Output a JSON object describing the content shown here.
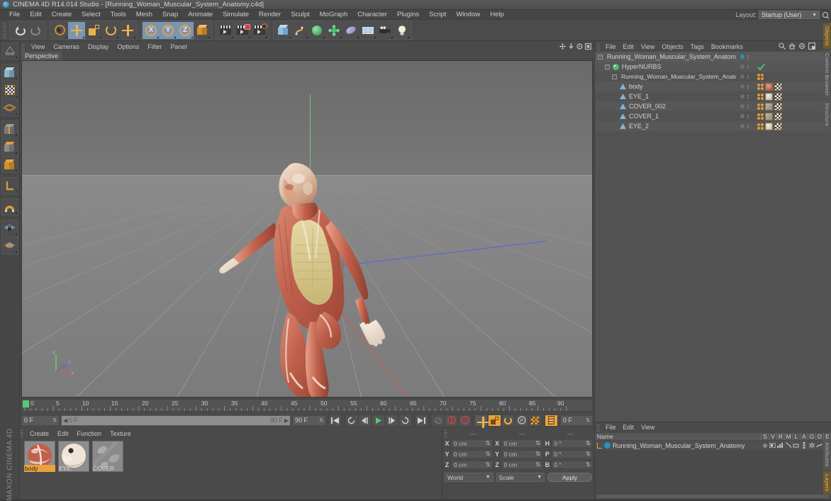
{
  "titlebar": {
    "app_icon": "cinema4d-logo-icon",
    "title": "CINEMA 4D R14.014 Studio - [Running_Woman_Muscular_System_Anatomy.c4d]"
  },
  "menubar": {
    "items": [
      "File",
      "Edit",
      "Create",
      "Select",
      "Tools",
      "Mesh",
      "Snap",
      "Animate",
      "Simulate",
      "Render",
      "Sculpt",
      "MoGraph",
      "Character",
      "Plugins",
      "Script",
      "Window",
      "Help"
    ],
    "layout_label": "Layout:",
    "layout_value": "Startup (User)",
    "search_icon": "magnifier-icon"
  },
  "toolbar": {
    "groups": [
      {
        "name": "history",
        "buttons": [
          {
            "icon": "undo-icon",
            "state": "normal"
          },
          {
            "icon": "redo-icon",
            "state": "disabled"
          }
        ]
      },
      {
        "name": "transform",
        "buttons": [
          {
            "icon": "selection-live-icon",
            "state": "normal"
          },
          {
            "icon": "move-icon",
            "state": "selected"
          },
          {
            "icon": "scale-icon",
            "state": "normal"
          },
          {
            "icon": "rotate-icon",
            "state": "normal"
          },
          {
            "icon": "add-move-icon",
            "state": "normal"
          }
        ]
      },
      {
        "name": "axis-locks",
        "buttons": [
          {
            "icon": "x-axis-icon",
            "state": "selected"
          },
          {
            "icon": "y-axis-icon",
            "state": "selected"
          },
          {
            "icon": "z-axis-icon",
            "state": "selected"
          },
          {
            "icon": "world-object-axis-icon",
            "state": "normal"
          }
        ]
      },
      {
        "name": "render",
        "buttons": [
          {
            "icon": "render-view-icon",
            "state": "normal"
          },
          {
            "icon": "render-region-icon",
            "state": "normal"
          },
          {
            "icon": "render-settings-icon",
            "state": "normal"
          }
        ]
      },
      {
        "name": "objects",
        "buttons": [
          {
            "icon": "cube-primitive-icon",
            "state": "normal"
          },
          {
            "icon": "spline-pen-icon",
            "state": "normal"
          },
          {
            "icon": "nurbs-icon",
            "state": "normal"
          },
          {
            "icon": "array-modeling-icon",
            "state": "normal"
          },
          {
            "icon": "deformer-icon",
            "state": "normal"
          },
          {
            "icon": "environment-icon",
            "state": "normal"
          },
          {
            "icon": "camera-icon",
            "state": "normal"
          },
          {
            "icon": "light-icon",
            "state": "normal"
          }
        ]
      }
    ]
  },
  "left_toolbar": {
    "buttons": [
      {
        "icon": "make-editable-icon"
      },
      {
        "icon": "model-mode-icon"
      },
      {
        "icon": "texture-mode-icon"
      },
      {
        "icon": "points-mode-icon"
      },
      {
        "icon": "edges-mode-icon"
      },
      {
        "icon": "polygons-mode-icon"
      },
      {
        "icon": "axis-mode-icon"
      },
      {
        "icon": "workplane-icon"
      },
      {
        "icon": "magnet-icon"
      },
      {
        "icon": "lock-workplane-icon"
      },
      {
        "icon": "planar-workplane-icon"
      }
    ],
    "brand": "MAXON CINEMA 4D"
  },
  "viewport": {
    "menu_items": [
      "View",
      "Cameras",
      "Display",
      "Options",
      "Filter",
      "Panel"
    ],
    "view_label": "Perspective",
    "nav_icons": [
      "pan-icon",
      "zoom-icon",
      "rotate-icon",
      "maximize-viewport-icon"
    ],
    "axis_gizmo": [
      "x-axis-red",
      "y-axis-green",
      "z-axis-blue"
    ],
    "scene_description": "Running woman muscular system anatomy 3D model on grey perspective grid"
  },
  "timeline": {
    "ruler_labels": [
      "0",
      "5",
      "10",
      "15",
      "20",
      "25",
      "30",
      "35",
      "40",
      "45",
      "50",
      "55",
      "60",
      "65",
      "70",
      "75",
      "80",
      "85",
      "90"
    ],
    "range_start": 0,
    "range_end": 90,
    "current_frame": 0,
    "current_frame_field": "0 F",
    "preview_start_field": "0 F",
    "preview_end_field": "90 F",
    "end_frame_field": "90 F",
    "right_frame_field": "0 F",
    "transport": [
      {
        "icon": "go-to-start-icon"
      },
      {
        "icon": "previous-key-icon"
      },
      {
        "icon": "step-back-icon"
      },
      {
        "icon": "play-icon"
      },
      {
        "icon": "step-forward-icon"
      },
      {
        "icon": "next-key-icon"
      },
      {
        "icon": "go-to-end-icon"
      }
    ],
    "record_group": [
      {
        "icon": "autokey-icon"
      },
      {
        "icon": "record-active-objects-icon"
      },
      {
        "icon": "record-question-icon"
      }
    ],
    "key_group": [
      {
        "icon": "key-position-icon"
      },
      {
        "icon": "key-scale-icon"
      },
      {
        "icon": "key-rotation-icon"
      },
      {
        "icon": "key-param-icon"
      },
      {
        "icon": "key-pla-icon"
      },
      {
        "icon": "timeline-icon"
      }
    ]
  },
  "material_manager": {
    "menu_items": [
      "Create",
      "Edit",
      "Function",
      "Texture"
    ],
    "materials": [
      {
        "name": "body",
        "selected": true,
        "swatch": "muscle-red"
      },
      {
        "name": "EYE",
        "selected": false,
        "swatch": "eye-cream"
      },
      {
        "name": "COVER",
        "selected": false,
        "swatch": "cover-grey"
      }
    ]
  },
  "coordinates": {
    "column_headers": [
      "—",
      "—",
      "—"
    ],
    "position": [
      {
        "label": "X",
        "value": "0 cm"
      },
      {
        "label": "Y",
        "value": "0 cm"
      },
      {
        "label": "Z",
        "value": "0 cm"
      }
    ],
    "size": [
      {
        "label": "X",
        "value": "0 cm"
      },
      {
        "label": "Y",
        "value": "0 cm"
      },
      {
        "label": "Z",
        "value": "0 cm"
      }
    ],
    "rotation": [
      {
        "label": "H",
        "value": "0 °"
      },
      {
        "label": "P",
        "value": "0 °"
      },
      {
        "label": "B",
        "value": "0 °"
      }
    ],
    "coord_system": "World",
    "mode": "Scale",
    "apply_label": "Apply"
  },
  "object_manager": {
    "menu_items": [
      "File",
      "Edit",
      "View",
      "Objects",
      "Tags",
      "Bookmarks"
    ],
    "tool_icons": [
      "search-icon",
      "home-icon",
      "minus-icon",
      "new-window-icon"
    ],
    "rows": [
      {
        "name": "Running_Woman_Muscular_System_Anatomy",
        "depth": 0,
        "icon": "null-object-icon",
        "expander": "-",
        "dot": "on",
        "check": false,
        "tags": []
      },
      {
        "name": "HyperNURBS",
        "depth": 1,
        "icon": "hypernurbs-icon",
        "expander": "-",
        "dot": "off",
        "check": true,
        "tags": []
      },
      {
        "name": "Running_Woman_Muscular_System_Anatomy",
        "depth": 2,
        "icon": "null-object-icon",
        "expander": "-",
        "dot": "off",
        "check": false,
        "tags": [
          "dots"
        ]
      },
      {
        "name": "body",
        "depth": 3,
        "icon": "polygon-object-icon",
        "expander": "",
        "dot": "off",
        "check": false,
        "tags": [
          "dots",
          "material-muscle",
          "uvw-checker"
        ]
      },
      {
        "name": "EYE_1",
        "depth": 3,
        "icon": "polygon-object-icon",
        "expander": "",
        "dot": "off",
        "check": false,
        "tags": [
          "dots",
          "material-eye",
          "uvw-checker"
        ]
      },
      {
        "name": "COVER_002",
        "depth": 3,
        "icon": "polygon-object-icon",
        "expander": "",
        "dot": "off",
        "check": false,
        "tags": [
          "dots",
          "material-cover",
          "uvw-checker"
        ]
      },
      {
        "name": "COVER_1",
        "depth": 3,
        "icon": "polygon-object-icon",
        "expander": "",
        "dot": "off",
        "check": false,
        "tags": [
          "dots",
          "material-cover",
          "uvw-checker"
        ]
      },
      {
        "name": "EYE_2",
        "depth": 3,
        "icon": "polygon-object-icon",
        "expander": "",
        "dot": "off",
        "check": false,
        "tags": [
          "dots",
          "material-eye",
          "uvw-checker"
        ]
      }
    ]
  },
  "attribute_manager": {
    "menu_items": [
      "File",
      "Edit",
      "View"
    ],
    "name_header": "Name",
    "column_headers": [
      "S",
      "V",
      "R",
      "M",
      "L",
      "A",
      "G",
      "D",
      "E"
    ],
    "rows": [
      {
        "name": "Running_Woman_Muscular_System_Anatomy",
        "swatch": "#2b8fc4"
      }
    ]
  },
  "side_tabs": {
    "top": [
      {
        "label": "Objects",
        "active": true
      },
      {
        "label": "Content Browser",
        "active": false
      },
      {
        "label": "Structure",
        "active": false
      }
    ],
    "bottom": [
      {
        "label": "Attributes",
        "active": false
      },
      {
        "label": "Layers",
        "active": true
      }
    ]
  },
  "colors": {
    "accent_orange": "#e8a33d",
    "selection_blue": "#7a96b4",
    "panel_bg": "#4a4a4a",
    "list_bg": "#525252",
    "tag_blue": "#2b8fc4",
    "play_green": "#57c97a"
  }
}
